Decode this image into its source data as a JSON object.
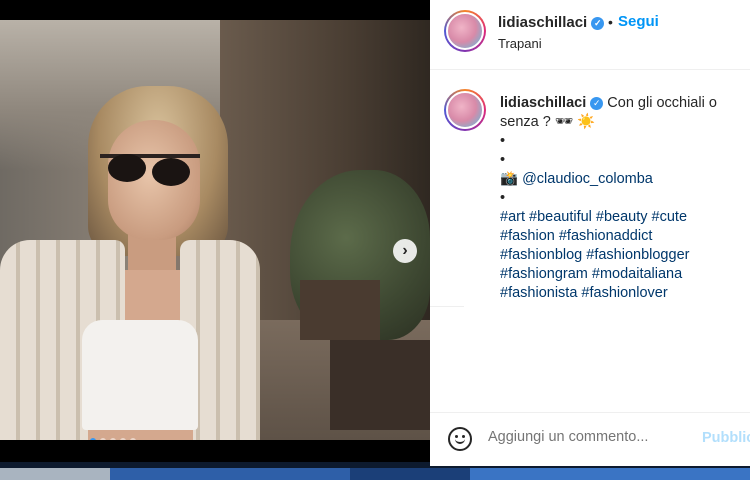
{
  "post": {
    "username": "lidiaschillaci",
    "verified_icon": "verified-badge-icon",
    "separator": "•",
    "follow_label": "Segui",
    "location": "Trapani",
    "more_icon": "more-options-icon"
  },
  "carousel": {
    "next_icon": "chevron-right-icon",
    "next_glyph": "›",
    "total_slides": 5,
    "active_slide": 1
  },
  "caption": {
    "username": "lidiaschillaci",
    "text": "Con gli occhiali o senza ? 🕶 ☀️",
    "dot_lines": [
      "•",
      "•"
    ],
    "credit": "📸 @claudioc_colomba",
    "dot_after_credit": "•",
    "hashtags_lines": [
      "#art #beautiful #beauty #cute",
      "#fashion #fashionaddict",
      "#fashionblog #fashionblogger",
      "#fashiongram #modaitaliana",
      "#fashionista #fashionlover"
    ]
  },
  "comment": {
    "emoji_icon": "smiley-icon",
    "placeholder": "Aggiungi un commento...",
    "publish_label": "Pubblica"
  },
  "colors": {
    "accent": "#0095f6",
    "publish_disabled": "#b2dffc",
    "link": "#00376b"
  }
}
